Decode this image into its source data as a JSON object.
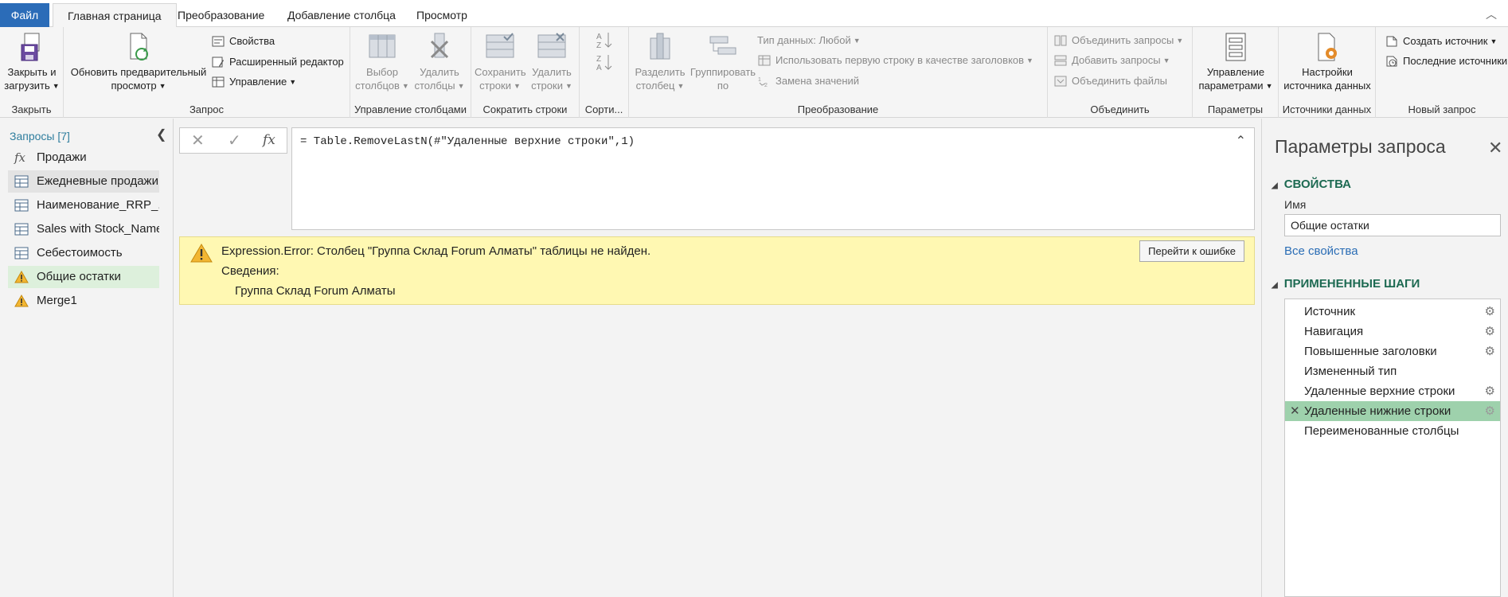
{
  "tabs": {
    "file": "Файл",
    "home": "Главная страница",
    "transform": "Преобразование",
    "add_column": "Добавление столбца",
    "view": "Просмотр"
  },
  "ribbon": {
    "close_group": {
      "label": "Закрыть",
      "close_load_l1": "Закрыть и",
      "close_load_l2": "загрузить"
    },
    "query_group": {
      "label": "Запрос",
      "refresh_l1": "Обновить предварительный",
      "refresh_l2": "просмотр",
      "properties": "Свойства",
      "advanced_editor": "Расширенный редактор",
      "manage": "Управление"
    },
    "manage_columns_group": {
      "label": "Управление столбцами",
      "choose_l1": "Выбор",
      "choose_l2": "столбцов",
      "remove_l1": "Удалить",
      "remove_l2": "столбцы"
    },
    "reduce_rows_group": {
      "label": "Сократить строки",
      "keep_l1": "Сохранить",
      "keep_l2": "строки",
      "remove_l1": "Удалить",
      "remove_l2": "строки"
    },
    "sort_group": {
      "label": "Сорти..."
    },
    "transform_group": {
      "label": "Преобразование",
      "split_l1": "Разделить",
      "split_l2": "столбец",
      "group_l1": "Группировать",
      "group_l2": "по",
      "data_type": "Тип данных: Любой",
      "first_row_header": "Использовать первую строку в качестве заголовков",
      "replace_values": "Замена значений"
    },
    "combine_group": {
      "label": "Объединить",
      "merge_queries": "Объединить запросы",
      "append_queries": "Добавить запросы",
      "combine_files": "Объединить файлы"
    },
    "params_group": {
      "label": "Параметры",
      "manage_l1": "Управление",
      "manage_l2": "параметрами"
    },
    "datasources_group": {
      "label": "Источники данных",
      "settings_l1": "Настройки",
      "settings_l2": "источника данных"
    },
    "newquery_group": {
      "label": "Новый запрос",
      "new_source": "Создать источник",
      "recent_sources": "Последние источники"
    }
  },
  "queries": {
    "header": "Запросы [7]",
    "items": [
      {
        "label": "Продажи",
        "icon": "fx-icon"
      },
      {
        "label": "Ежедневные продажи",
        "icon": "table-icon"
      },
      {
        "label": "Наименование_RRP_...",
        "icon": "table-icon"
      },
      {
        "label": "Sales with Stock_Name",
        "icon": "table-icon"
      },
      {
        "label": "Себестоимость",
        "icon": "table-icon"
      },
      {
        "label": "Общие остатки",
        "icon": "warning-icon"
      },
      {
        "label": "Merge1",
        "icon": "warning-icon"
      }
    ]
  },
  "formula": {
    "text": "= Table.RemoveLastN(#\"Удаленные верхние строки\",1)",
    "fx": "fx"
  },
  "error": {
    "message": "Expression.Error: Столбец \"Группа Склад Forum Алматы\" таблицы не найден.",
    "details_label": "Сведения:",
    "details_value": "Группа Склад Forum Алматы",
    "goto_button": "Перейти к ошибке"
  },
  "settings": {
    "title": "Параметры запроса",
    "properties_header": "СВОЙСТВА",
    "name_label": "Имя",
    "name_value": "Общие остатки",
    "all_properties": "Все свойства",
    "steps_header": "ПРИМЕНЕННЫЕ ШАГИ",
    "steps": [
      "Источник",
      "Навигация",
      "Повышенные заголовки",
      "Измененный тип",
      "Удаленные верхние строки",
      "Удаленные нижние строки",
      "Переименованные столбцы"
    ]
  },
  "colors": {
    "accent": "#2b6cb8",
    "error_bg": "#fff8b2",
    "selected_step": "#9ed1ac",
    "section_green": "#1d6a52"
  }
}
